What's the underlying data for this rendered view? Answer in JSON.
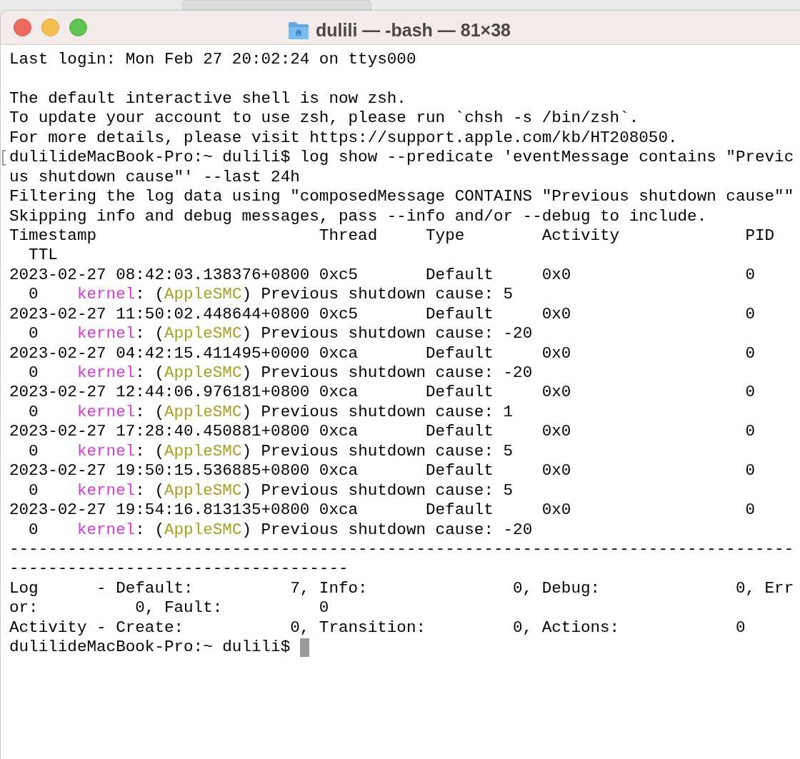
{
  "window": {
    "title": "dulili — -bash — 81×38"
  },
  "lines": [
    {
      "kind": "text",
      "text": "Last login: Mon Feb 27 20:02:24 on ttys000"
    },
    {
      "kind": "blank"
    },
    {
      "kind": "text",
      "text": "The default interactive shell is now zsh."
    },
    {
      "kind": "text",
      "text": "To update your account to use zsh, please run `chsh -s /bin/zsh`."
    },
    {
      "kind": "text",
      "text": "For more details, please visit https://support.apple.com/kb/HT208050."
    },
    {
      "kind": "marked",
      "text": "dulilideMacBook-Pro:~ dulili$ log show --predicate 'eventMessage contains \"Previc"
    },
    {
      "kind": "text",
      "text": "us shutdown cause\"' --last 24h"
    },
    {
      "kind": "text",
      "text": "Filtering the log data using \"composedMessage CONTAINS \"Previous shutdown cause\"\""
    },
    {
      "kind": "text",
      "text": "Skipping info and debug messages, pass --info and/or --debug to include."
    },
    {
      "kind": "text",
      "text": "Timestamp                       Thread     Type        Activity             PID"
    },
    {
      "kind": "text",
      "text": "  TTL"
    },
    {
      "kind": "text",
      "text": "2023-02-27 08:42:03.138376+0800 0xc5       Default     0x0                  0"
    },
    {
      "kind": "entry",
      "prefix": "  0    ",
      "process": "kernel",
      "middle": ": (",
      "subsystem": "AppleSMC",
      "rest": ") Previous shutdown cause: 5"
    },
    {
      "kind": "text",
      "text": "2023-02-27 11:50:02.448644+0800 0xc5       Default     0x0                  0"
    },
    {
      "kind": "entry",
      "prefix": "  0    ",
      "process": "kernel",
      "middle": ": (",
      "subsystem": "AppleSMC",
      "rest": ") Previous shutdown cause: -20"
    },
    {
      "kind": "text",
      "text": "2023-02-27 04:42:15.411495+0000 0xca       Default     0x0                  0"
    },
    {
      "kind": "entry",
      "prefix": "  0    ",
      "process": "kernel",
      "middle": ": (",
      "subsystem": "AppleSMC",
      "rest": ") Previous shutdown cause: -20"
    },
    {
      "kind": "text",
      "text": "2023-02-27 12:44:06.976181+0800 0xca       Default     0x0                  0"
    },
    {
      "kind": "entry",
      "prefix": "  0    ",
      "process": "kernel",
      "middle": ": (",
      "subsystem": "AppleSMC",
      "rest": ") Previous shutdown cause: 1"
    },
    {
      "kind": "text",
      "text": "2023-02-27 17:28:40.450881+0800 0xca       Default     0x0                  0"
    },
    {
      "kind": "entry",
      "prefix": "  0    ",
      "process": "kernel",
      "middle": ": (",
      "subsystem": "AppleSMC",
      "rest": ") Previous shutdown cause: 5"
    },
    {
      "kind": "text",
      "text": "2023-02-27 19:50:15.536885+0800 0xca       Default     0x0                  0"
    },
    {
      "kind": "entry",
      "prefix": "  0    ",
      "process": "kernel",
      "middle": ": (",
      "subsystem": "AppleSMC",
      "rest": ") Previous shutdown cause: 5"
    },
    {
      "kind": "text",
      "text": "2023-02-27 19:54:16.813135+0800 0xca       Default     0x0                  0"
    },
    {
      "kind": "entry",
      "prefix": "  0    ",
      "process": "kernel",
      "middle": ": (",
      "subsystem": "AppleSMC",
      "rest": ") Previous shutdown cause: -20"
    },
    {
      "kind": "text",
      "text": "---------------------------------------------------------------------------------"
    },
    {
      "kind": "text",
      "text": "-----------------------------------"
    },
    {
      "kind": "text",
      "text": "Log      - Default:          7, Info:               0, Debug:              0, Err"
    },
    {
      "kind": "text",
      "text": "or:          0, Fault:          0"
    },
    {
      "kind": "text",
      "text": "Activity - Create:           0, Transition:         0, Actions:            0"
    },
    {
      "kind": "prompt",
      "text": "dulilideMacBook-Pro:~ dulili$ ",
      "cursor": true
    }
  ]
}
